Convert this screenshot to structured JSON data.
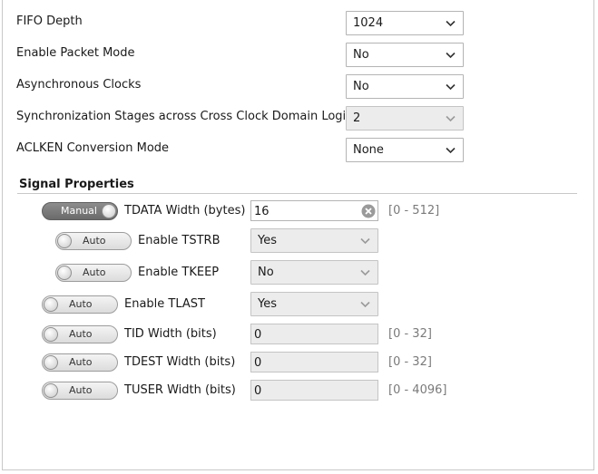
{
  "top_fields": [
    {
      "label": "FIFO Depth",
      "value": "1024",
      "disabled": false
    },
    {
      "label": "Enable Packet Mode",
      "value": "No",
      "disabled": false
    },
    {
      "label": "Asynchronous Clocks",
      "value": "No",
      "disabled": false
    },
    {
      "label": "Synchronization Stages across Cross Clock Domain Logic",
      "value": "2",
      "disabled": true
    },
    {
      "label": "ACLKEN Conversion Mode",
      "value": "None",
      "disabled": false
    }
  ],
  "signal_properties": {
    "title": "Signal Properties",
    "rows": [
      {
        "toggle": "Manual",
        "label": "TDATA Width (bytes)",
        "value": "16",
        "range": "[0 - 512]"
      },
      {
        "toggle": "Auto",
        "label": "Enable TSTRB",
        "value": "Yes",
        "range": ""
      },
      {
        "toggle": "Auto",
        "label": "Enable TKEEP",
        "value": "No",
        "range": ""
      },
      {
        "toggle": "Auto",
        "label": "Enable TLAST",
        "value": "Yes",
        "range": ""
      },
      {
        "toggle": "Auto",
        "label": "TID Width (bits)",
        "value": "0",
        "range": "[0 - 32]"
      },
      {
        "toggle": "Auto",
        "label": "TDEST Width (bits)",
        "value": "0",
        "range": "[0 - 32]"
      },
      {
        "toggle": "Auto",
        "label": "TUSER Width (bits)",
        "value": "0",
        "range": "[0 - 4096]"
      }
    ]
  },
  "colors": {
    "manual_toggle": "#777777",
    "disabled_field": "#ececec",
    "range_text": "#7a7a7a"
  }
}
